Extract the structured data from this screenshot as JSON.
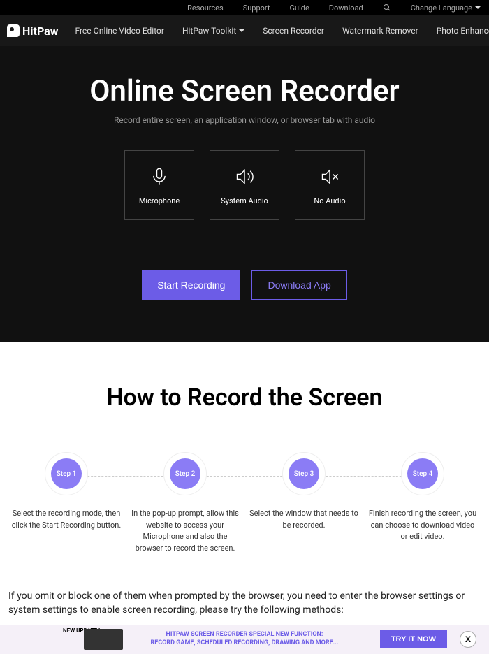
{
  "topbar": {
    "resources": "Resources",
    "support": "Support",
    "guide": "Guide",
    "download": "Download",
    "language": "Change Language"
  },
  "brand": "HitPaw",
  "nav": {
    "editor": "Free Online Video Editor",
    "toolkit": "HitPaw Toolkit",
    "recorder": "Screen Recorder",
    "watermark": "Watermark Remover",
    "photo": "Photo Enhancer"
  },
  "hero": {
    "title": "Online Screen Recorder",
    "subtitle": "Record entire screen, an application window, or browser tab with audio",
    "opt_mic": "Microphone",
    "opt_sys": "System Audio",
    "opt_none": "No Audio",
    "start": "Start Recording",
    "dl": "Download App"
  },
  "howto": {
    "title": "How to Record the Screen",
    "steps": [
      {
        "badge": "Step 1",
        "text": "Select the recording mode, then click the Start Recording button."
      },
      {
        "badge": "Step 2",
        "text": "In the pop-up prompt, allow this website to access your Microphone and also the browser to record the screen."
      },
      {
        "badge": "Step 3",
        "text": "Select the window that needs to be recorded."
      },
      {
        "badge": "Step 4",
        "text": "Finish recording the screen, you can choose to download video or edit video."
      }
    ]
  },
  "note": "If you omit or block one of them when prompted by the browser, you need to enter the browser settings or system settings to enable screen recording, please try the following methods:",
  "banner": {
    "new": "NEW UPDATE !",
    "line1": "HITPAW SCREEN RECORDER SPECIAL NEW FUNCTION:",
    "line2": "RECORD GAME, SCHEDULED RECORDING, DRAWING AND MORE...",
    "try": "TRY IT NOW",
    "close": "X"
  }
}
